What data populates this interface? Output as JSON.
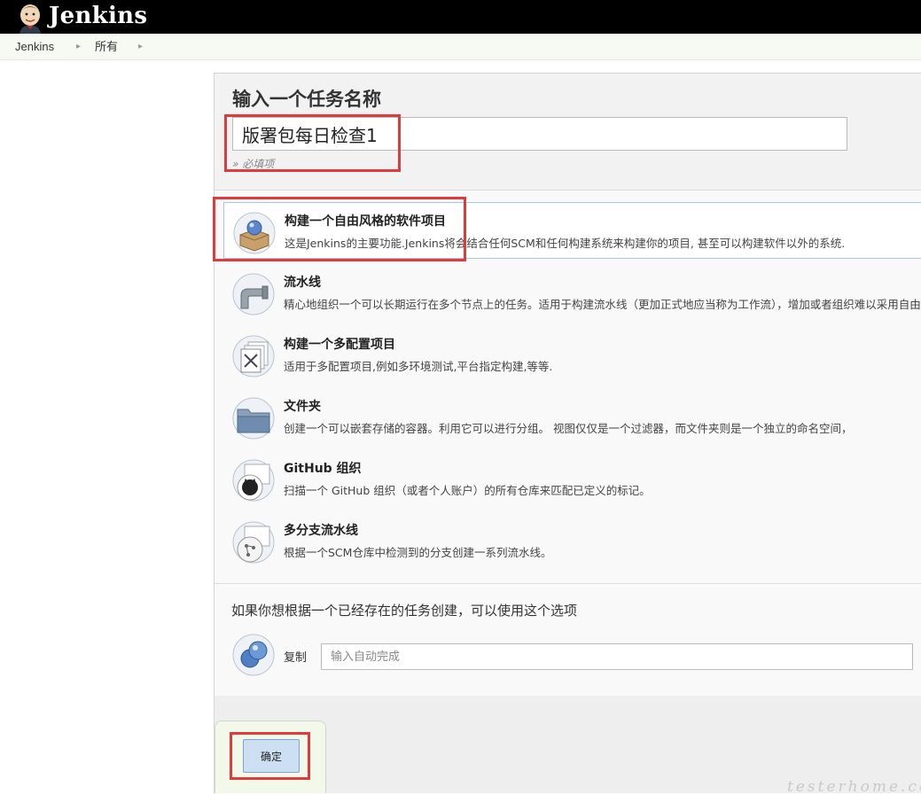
{
  "header": {
    "logo_text": "Jenkins",
    "breadcrumbs": [
      "Jenkins",
      "所有"
    ]
  },
  "new_item": {
    "title": "输入一个任务名称",
    "name_value": "版署包每日检查1",
    "required_hint": "» 必填项"
  },
  "item_types": [
    {
      "title": "构建一个自由风格的软件项目",
      "description": "这是Jenkins的主要功能.Jenkins将会结合任何SCM和任何构建系统来构建你的项目, 甚至可以构建软件以外的系统.",
      "icon": "freestyle-package-icon",
      "selected": true
    },
    {
      "title": "流水线",
      "description": "精心地组织一个可以长期运行在多个节点上的任务。适用于构建流水线（更加正式地应当称为工作流），增加或者组织难以采用自由风格",
      "icon": "pipeline-icon",
      "selected": false
    },
    {
      "title": "构建一个多配置项目",
      "description": "适用于多配置项目,例如多环境测试,平台指定构建,等等.",
      "icon": "multi-config-icon",
      "selected": false
    },
    {
      "title": "文件夹",
      "description": "创建一个可以嵌套存储的容器。利用它可以进行分组。 视图仅仅是一个过滤器，而文件夹则是一个独立的命名空间，",
      "icon": "folder-icon",
      "selected": false
    },
    {
      "title": "GitHub 组织",
      "description": "扫描一个 GitHub 组织（或者个人账户）的所有仓库来匹配已定义的标记。",
      "icon": "github-organization-icon",
      "selected": false
    },
    {
      "title": "多分支流水线",
      "description": "根据一个SCM仓库中检测到的分支创建一系列流水线。",
      "icon": "multibranch-pipeline-icon",
      "selected": false
    }
  ],
  "copy": {
    "title": "如果你想根据一个已经存在的任务创建，可以使用这个选项",
    "label": "复制",
    "placeholder": "输入自动完成"
  },
  "ok_button": "确定",
  "watermark": "testerhome.com",
  "colors": {
    "header_bg": "#000000",
    "highlight": "#e03a3a",
    "button_bg": "#cde0f3"
  }
}
